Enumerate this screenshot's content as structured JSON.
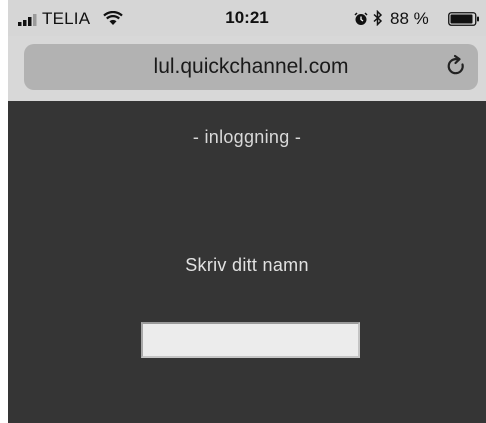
{
  "status_bar": {
    "carrier": "TELIA",
    "time": "10:21",
    "battery_percent": "88 %",
    "icons": [
      "signal-icon",
      "wifi-icon",
      "alarm-icon",
      "bluetooth-icon",
      "battery-icon"
    ]
  },
  "address_bar": {
    "url": "lul.quickchannel.com",
    "reload_icon": "reload-icon"
  },
  "page": {
    "subtitle": "- inloggning -",
    "prompt": "Skriv ditt namn",
    "name_input_value": ""
  },
  "colors": {
    "content_background": "#353535",
    "address_bar_background": "#b2b2b2",
    "status_bar_background": "#d6d6d6"
  }
}
